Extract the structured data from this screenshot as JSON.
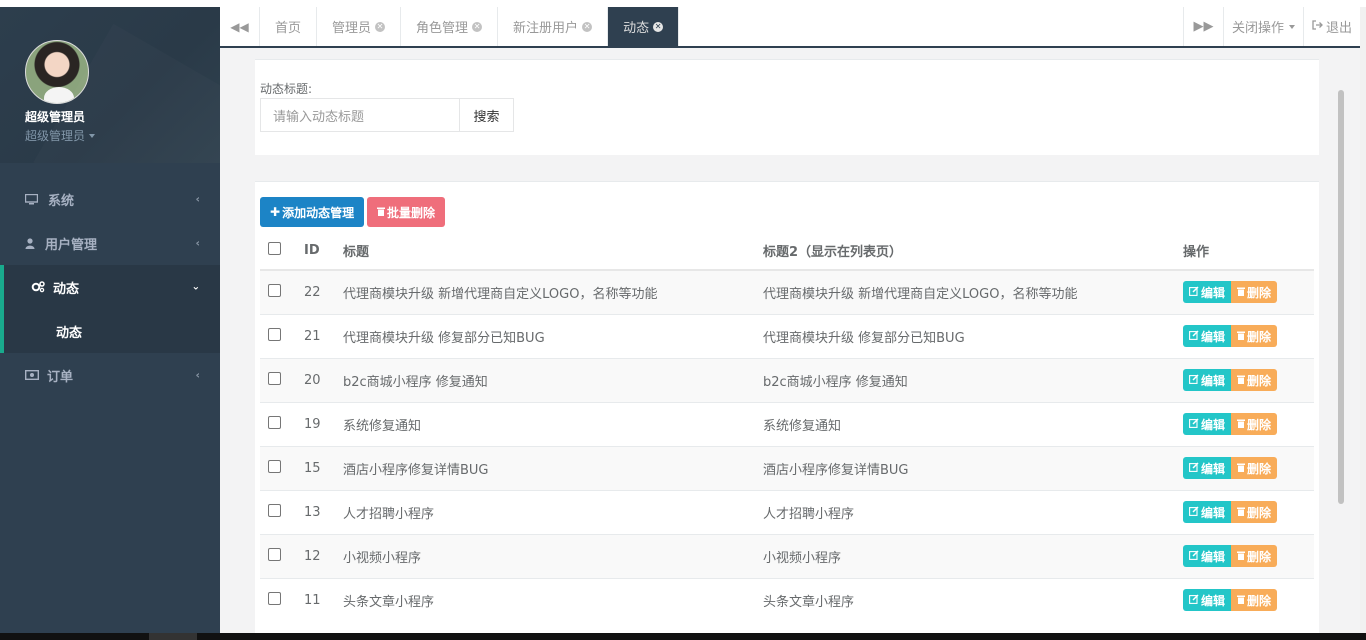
{
  "profile": {
    "name": "超级管理员",
    "role": "超级管理员"
  },
  "sidebar": {
    "items": [
      {
        "label": "系统",
        "icon": "monitor-icon"
      },
      {
        "label": "用户管理",
        "icon": "user-icon"
      },
      {
        "label": "动态",
        "icon": "gears-icon",
        "active": true
      },
      {
        "label": "订单",
        "icon": "money-icon"
      }
    ],
    "sub_item": "动态"
  },
  "tabs": {
    "items": [
      "首页",
      "管理员",
      "角色管理",
      "新注册用户",
      "动态"
    ],
    "active": "动态",
    "close_ops": "关闭操作",
    "logout": "退出"
  },
  "search": {
    "label": "动态标题:",
    "placeholder": "请输入动态标题",
    "button": "搜索"
  },
  "toolbar": {
    "add_label": "添加动态管理",
    "batch_delete_label": "批量删除"
  },
  "table": {
    "headers": {
      "id": "ID",
      "title": "标题",
      "title2": "标题2（显示在列表页）",
      "ops": "操作"
    },
    "edit_label": "编辑",
    "delete_label": "删除",
    "rows": [
      {
        "id": "22",
        "title": "代理商模块升级 新增代理商自定义LOGO，名称等功能",
        "title2": "代理商模块升级 新增代理商自定义LOGO，名称等功能"
      },
      {
        "id": "21",
        "title": "代理商模块升级 修复部分已知BUG",
        "title2": "代理商模块升级 修复部分已知BUG"
      },
      {
        "id": "20",
        "title": "b2c商城小程序 修复通知",
        "title2": "b2c商城小程序 修复通知"
      },
      {
        "id": "19",
        "title": "系统修复通知",
        "title2": "系统修复通知"
      },
      {
        "id": "15",
        "title": "酒店小程序修复详情BUG",
        "title2": "酒店小程序修复详情BUG"
      },
      {
        "id": "13",
        "title": "人才招聘小程序",
        "title2": "人才招聘小程序"
      },
      {
        "id": "12",
        "title": "小视频小程序",
        "title2": "小视频小程序"
      },
      {
        "id": "11",
        "title": "头条文章小程序",
        "title2": "头条文章小程序"
      }
    ]
  },
  "colors": {
    "sidebar_bg": "#2f4050",
    "accent": "#19aa8d",
    "primary": "#1c84c6",
    "danger": "#ed5565",
    "info": "#23c6c8",
    "warning": "#f8ac59"
  }
}
